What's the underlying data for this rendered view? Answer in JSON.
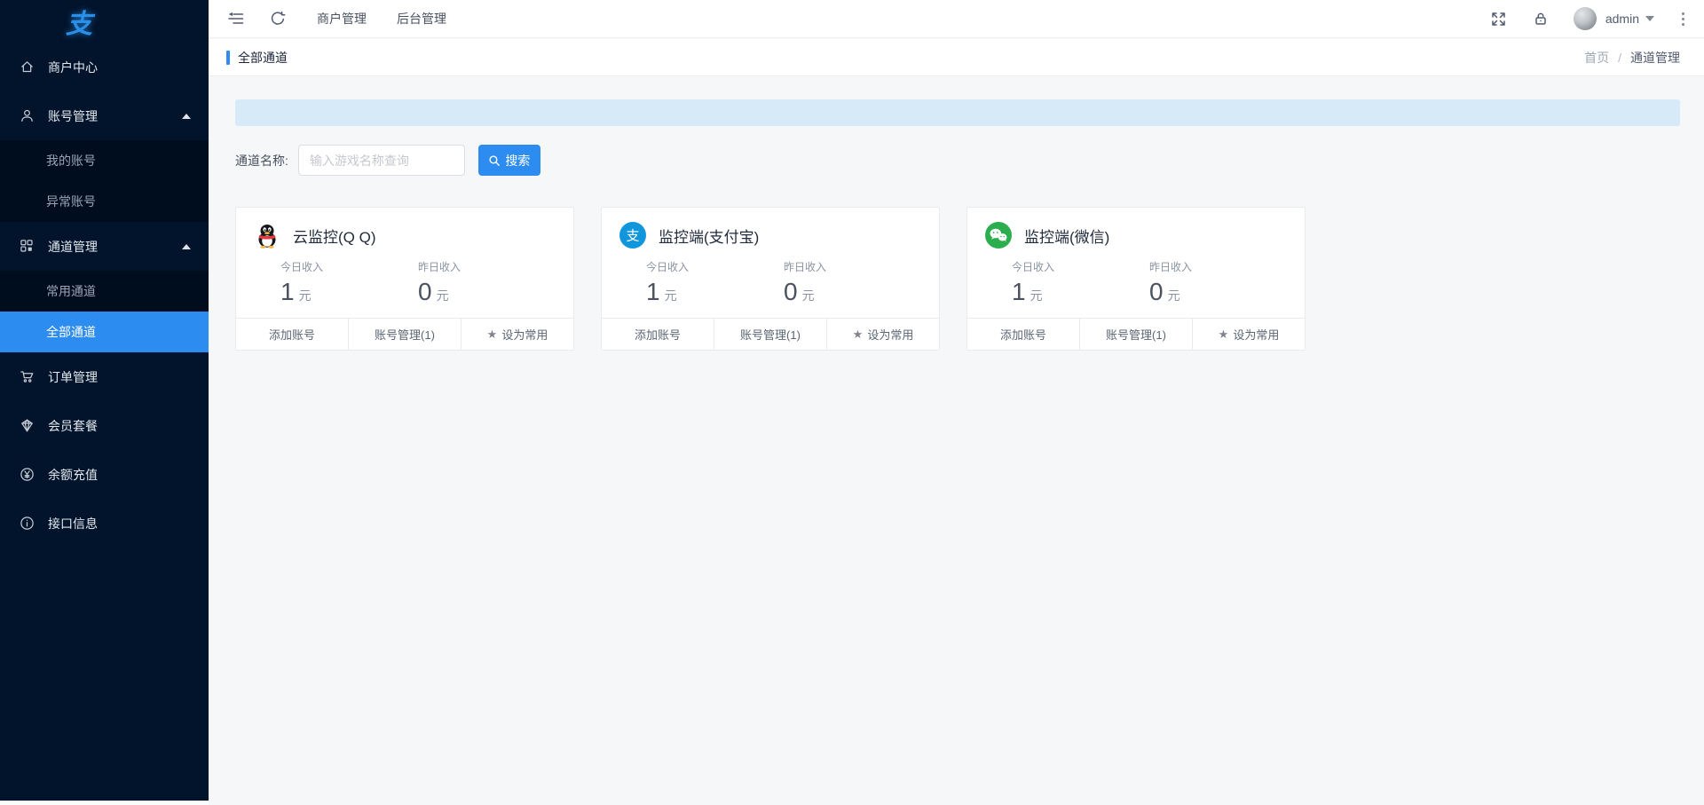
{
  "app": {
    "logo_char": "支"
  },
  "header": {
    "nav": [
      {
        "label": "商户管理"
      },
      {
        "label": "后台管理"
      }
    ],
    "user": {
      "name": "admin"
    }
  },
  "page": {
    "title": "全部通道",
    "breadcrumb": {
      "home": "首页",
      "separator": "/",
      "current": "通道管理"
    }
  },
  "search": {
    "label": "通道名称:",
    "placeholder": "输入游戏名称查询",
    "button_label": "搜索"
  },
  "sidebar": {
    "items": [
      {
        "label": "商户中心"
      },
      {
        "label": "账号管理"
      },
      {
        "label": "我的账号"
      },
      {
        "label": "异常账号"
      },
      {
        "label": "通道管理"
      },
      {
        "label": "常用通道"
      },
      {
        "label": "全部通道"
      },
      {
        "label": "订单管理"
      },
      {
        "label": "会员套餐"
      },
      {
        "label": "余额充值"
      },
      {
        "label": "接口信息"
      }
    ]
  },
  "cards": [
    {
      "title": "云监控(Q Q)",
      "stats": [
        {
          "label": "今日收入",
          "value": "1",
          "unit": "元"
        },
        {
          "label": "昨日收入",
          "value": "0",
          "unit": "元"
        }
      ],
      "actions": [
        "添加账号",
        "账号管理(1)",
        "设为常用"
      ],
      "star_glyph": "★"
    },
    {
      "title": "监控端(支付宝)",
      "icon_char": "支",
      "stats": [
        {
          "label": "今日收入",
          "value": "1",
          "unit": "元"
        },
        {
          "label": "昨日收入",
          "value": "0",
          "unit": "元"
        }
      ],
      "actions": [
        "添加账号",
        "账号管理(1)",
        "设为常用"
      ],
      "star_glyph": "★"
    },
    {
      "title": "监控端(微信)",
      "stats": [
        {
          "label": "今日收入",
          "value": "1",
          "unit": "元"
        },
        {
          "label": "昨日收入",
          "value": "0",
          "unit": "元"
        }
      ],
      "actions": [
        "添加账号",
        "账号管理(1)",
        "设为常用"
      ],
      "star_glyph": "★"
    }
  ],
  "colors": {
    "accent": "#2d8cf0",
    "alert_bg": "#d7eaf8",
    "sidebar_bg": "#02142c",
    "qq_scarf_red": "#e23b3f",
    "alipay_blue": "#1296db",
    "wechat_green": "#2cae4f"
  }
}
